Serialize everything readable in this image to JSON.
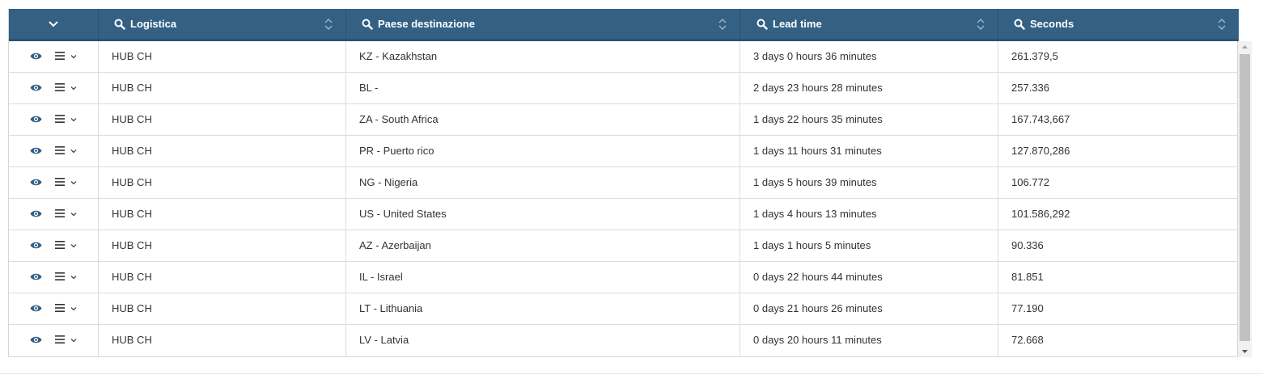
{
  "colors": {
    "header_bg": "#336083",
    "header_text": "#ffffff",
    "action_icon": "#2f5f86",
    "row_border": "#dcdcdc"
  },
  "header": {
    "expand_all_icon": "chevron-down-icon",
    "columns": [
      {
        "label": "Logistica",
        "icon": "search-icon",
        "sort_icon": "sort-icon"
      },
      {
        "label": "Paese destinazione",
        "icon": "search-icon",
        "sort_icon": "sort-icon"
      },
      {
        "label": "Lead time",
        "icon": "search-icon",
        "sort_icon": "sort-icon"
      },
      {
        "label": "Seconds",
        "icon": "search-icon",
        "sort_icon": "sort-icon"
      }
    ]
  },
  "row_actions": {
    "view_icon": "eye-icon",
    "menu_icon": "menu-icon",
    "menu_chevron_icon": "chevron-down-icon"
  },
  "rows": [
    {
      "logistica": "HUB CH",
      "paese": "KZ - Kazakhstan",
      "lead_time": "3 days 0 hours 36 minutes",
      "seconds": "261.379,5"
    },
    {
      "logistica": "HUB CH",
      "paese": "BL -",
      "lead_time": "2 days 23 hours 28 minutes",
      "seconds": "257.336"
    },
    {
      "logistica": "HUB CH",
      "paese": "ZA - South Africa",
      "lead_time": "1 days 22 hours 35 minutes",
      "seconds": "167.743,667"
    },
    {
      "logistica": "HUB CH",
      "paese": "PR - Puerto rico",
      "lead_time": "1 days 11 hours 31 minutes",
      "seconds": "127.870,286"
    },
    {
      "logistica": "HUB CH",
      "paese": "NG - Nigeria",
      "lead_time": "1 days 5 hours 39 minutes",
      "seconds": "106.772"
    },
    {
      "logistica": "HUB CH",
      "paese": "US - United States",
      "lead_time": "1 days 4 hours 13 minutes",
      "seconds": "101.586,292"
    },
    {
      "logistica": "HUB CH",
      "paese": "AZ - Azerbaijan",
      "lead_time": "1 days 1 hours 5 minutes",
      "seconds": "90.336"
    },
    {
      "logistica": "HUB CH",
      "paese": "IL - Israel",
      "lead_time": "0 days 22 hours 44 minutes",
      "seconds": "81.851"
    },
    {
      "logistica": "HUB CH",
      "paese": "LT - Lithuania",
      "lead_time": "0 days 21 hours 26 minutes",
      "seconds": "77.190"
    },
    {
      "logistica": "HUB CH",
      "paese": "LV - Latvia",
      "lead_time": "0 days 20 hours 11 minutes",
      "seconds": "72.668"
    }
  ]
}
